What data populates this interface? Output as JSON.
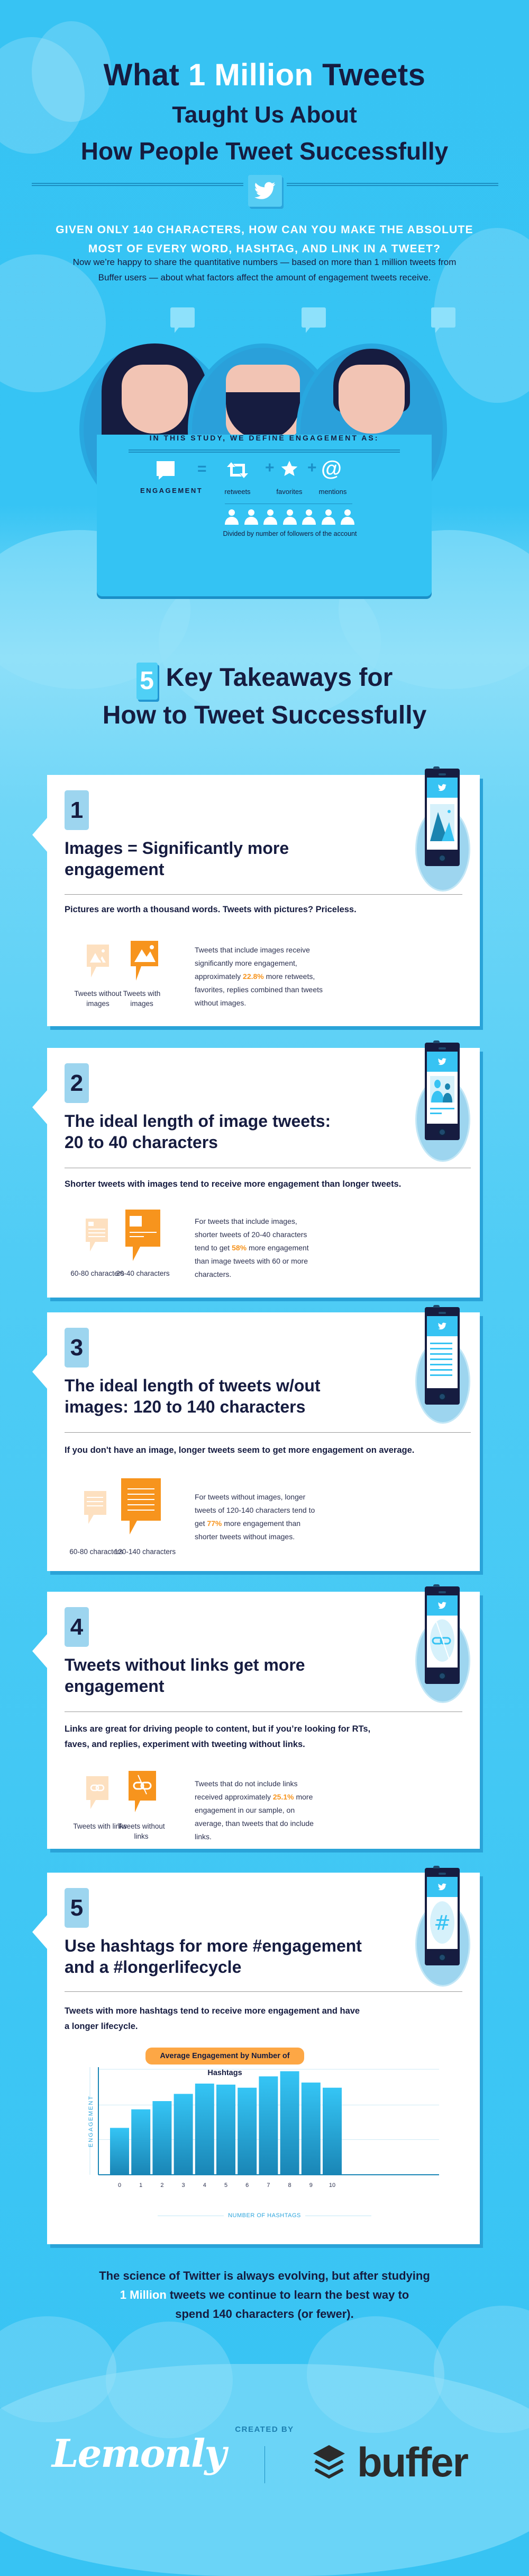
{
  "header": {
    "title_line1_pre": "What ",
    "title_line1_highlight": "1 Million",
    "title_line1_post": " Tweets",
    "title_line2": "Taught Us About",
    "title_line3": "How People Tweet Successfully",
    "logo_icon": "twitter-bird-icon"
  },
  "intro": {
    "question_line1": "GIVEN ONLY 140 CHARACTERS, HOW CAN YOU MAKE THE ABSOLUTE",
    "question_line2": "MOST OF EVERY WORD, HASHTAG, AND LINK IN A TWEET?",
    "body_line1": "Now we’re happy to share the quantitative numbers — based on more than 1 million tweets from",
    "body_line2": "Buffer users — about what factors affect the amount of engagement tweets receive."
  },
  "engagement_definition": {
    "title": "IN THIS STUDY, WE DEFINE ENGAGEMENT AS:",
    "engagement_label": "ENGAGEMENT",
    "equals": "=",
    "plus": "+",
    "components": [
      {
        "icon": "retweet-icon",
        "label": "retweets"
      },
      {
        "icon": "star-icon",
        "label": "favorites"
      },
      {
        "icon": "at-sign-icon",
        "label": "mentions"
      }
    ],
    "divisor_label": "Divided by number of followers of the account",
    "follower_icon_count": 7
  },
  "takeaways_header": {
    "number": "5",
    "line1": "Key Takeaways for",
    "line2": "How to Tweet Successfully"
  },
  "takeaways": [
    {
      "number": "1",
      "title": "Images = Significantly more engagement",
      "lead": "Pictures are worth a thousand words. Tweets with pictures? Priceless.",
      "icon_left_label": "Tweets without images",
      "icon_right_label": "Tweets with images",
      "body_pre": "Tweets that include images receive significantly more engagement, approximately ",
      "body_pct": "22.8%",
      "body_post": " more retweets, favorites, replies combined than tweets without images.",
      "phone_icon": "image-icon"
    },
    {
      "number": "2",
      "title": "The ideal length of image tweets: 20 to 40 characters",
      "lead": "Shorter tweets with images tend to receive more engagement than longer tweets.",
      "icon_left_label": "60-80 characters",
      "icon_right_label": "20-40 characters",
      "body_pre": "For tweets that include images, shorter tweets of 20-40 characters tend to get ",
      "body_pct": "58%",
      "body_post": " more engagement than image tweets with 60 or more characters.",
      "phone_icon": "people-icon"
    },
    {
      "number": "3",
      "title": "The ideal length of tweets w/out images: 120 to 140 characters",
      "lead": "If you don't have an image, longer tweets seem to get more engagement on average.",
      "icon_left_label": "60-80 characters",
      "icon_right_label": "120-140 characters",
      "body_pre": "For tweets without images, longer tweets of 120-140 characters tend to get ",
      "body_pct": "77%",
      "body_post": " more engagement than shorter tweets without images.",
      "phone_icon": "text-lines-icon"
    },
    {
      "number": "4",
      "title": "Tweets without links get more engagement",
      "lead": "Links are great for driving people to content, but if you’re looking for RTs, faves, and replies, experiment with tweeting without links.",
      "icon_left_label": "Tweets with links",
      "icon_right_label": "Tweets without links",
      "body_pre": "Tweets that do not include links received approximately ",
      "body_pct": "25.1%",
      "body_post": " more engagement in our sample, on average, than tweets that do include links.",
      "phone_icon": "broken-link-icon"
    },
    {
      "number": "5",
      "title": "Use hashtags for more #engagement and a #longerlifecycle",
      "lead": "Tweets with more hashtags tend to receive more engagement and have a longer lifecycle.",
      "phone_icon": "hashtag-icon"
    }
  ],
  "chart_data": {
    "type": "bar",
    "title": "Average Engagement by Number of Hashtags",
    "xlabel": "NUMBER OF HASHTAGS",
    "ylabel": "ENGAGEMENT",
    "categories": [
      "0",
      "1",
      "2",
      "3",
      "4",
      "5",
      "6",
      "7",
      "8",
      "9",
      "10"
    ],
    "values": [
      45,
      63,
      71,
      78,
      88,
      87,
      84,
      95,
      100,
      89,
      84
    ],
    "value_units": "relative (unlabeled axis, tallest bar = 100)",
    "ylim": [
      0,
      106
    ],
    "grid": true,
    "bar_color_top": "#35c5f5",
    "bar_color_bottom": "#1a86b6"
  },
  "closing": {
    "line1": "The science of Twitter is always evolving, but after studying",
    "line2_highlight": "1 Million",
    "line2_rest": " tweets we continue to learn the best way to",
    "line3": "spend 140 characters (or fewer)."
  },
  "credits": {
    "created_by": "CREATED BY",
    "partner1": "Lemonly",
    "partner2": "buffer"
  },
  "colors": {
    "navy": "#161c40",
    "sky": "#37c3f3",
    "orange": "#f7941d",
    "orange_light": "#fde0c0",
    "badge": "#9dd5ef"
  }
}
